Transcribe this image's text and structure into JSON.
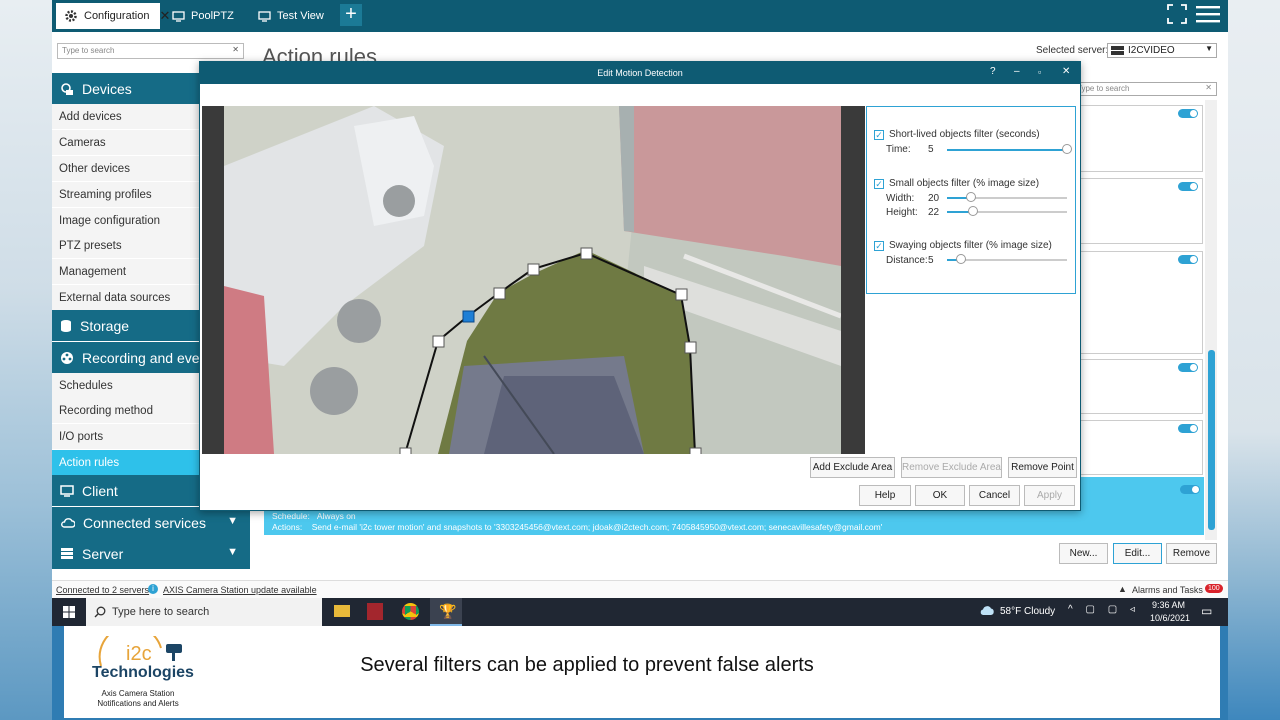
{
  "tabs": [
    {
      "label": "Configuration",
      "icon": "gear-icon"
    },
    {
      "label": "PoolPTZ",
      "icon": "monitor-icon"
    },
    {
      "label": "Test View",
      "icon": "monitor-icon"
    }
  ],
  "sidebar": {
    "search_placeholder": "Type to search",
    "devices": {
      "title": "Devices",
      "items": [
        "Add devices",
        "Cameras",
        "Other devices",
        "Streaming profiles",
        "Image configuration",
        "PTZ presets",
        "Management",
        "External data sources"
      ]
    },
    "storage": {
      "title": "Storage"
    },
    "recording": {
      "title": "Recording and events",
      "items": [
        "Schedules",
        "Recording method",
        "I/O ports",
        "Action rules"
      ]
    },
    "client": {
      "title": "Client"
    },
    "connected": {
      "title": "Connected services"
    },
    "server": {
      "title": "Server"
    }
  },
  "main": {
    "title": "Action rules",
    "selected_server_label": "Selected server:",
    "selected_server_value": "I2CVIDEO",
    "search_placeholder": "Type to search",
    "rule": {
      "schedule_label": "Schedule:",
      "schedule_value": "Always on",
      "actions_label": "Actions:",
      "actions_value": "Send e-mail 'i2c tower motion' and snapshots to '3303245456@vtext.com; jdoak@i2ctech.com; 7405845950@vtext.com; senecavillesafety@gmail.com'"
    },
    "buttons": {
      "new": "New...",
      "edit": "Edit...",
      "remove": "Remove"
    }
  },
  "status": {
    "connected": "Connected to 2 servers",
    "update": "AXIS Camera Station update available",
    "alarms": "Alarms and Tasks",
    "alarms_count": "100"
  },
  "dialog": {
    "title": "Edit Motion Detection",
    "help_icon": "?",
    "filters": {
      "short_lived": {
        "label": "Short-lived objects filter (seconds)",
        "checked": true,
        "time_label": "Time:",
        "time_value": "5",
        "level": 1.0
      },
      "small": {
        "label": "Small objects filter (% image size)",
        "checked": true,
        "width_label": "Width:",
        "width_value": "20",
        "width_level": 0.2,
        "height_label": "Height:",
        "height_value": "22",
        "height_level": 0.22
      },
      "swaying": {
        "label": "Swaying objects filter (% image size)",
        "checked": true,
        "distance_label": "Distance:",
        "distance_value": "5",
        "distance_level": 0.12
      }
    },
    "buttons": {
      "add_exclude": "Add Exclude Area",
      "remove_exclude": "Remove Exclude Area",
      "remove_point": "Remove Point",
      "help": "Help",
      "ok": "OK",
      "cancel": "Cancel",
      "apply": "Apply"
    }
  },
  "taskbar": {
    "search_placeholder": "Type here to search",
    "weather": "58°F  Cloudy",
    "time": "9:36 AM",
    "date": "10/6/2021"
  },
  "banner": {
    "caption": "Several filters can be applied to prevent false alerts",
    "logo_name": "i2c",
    "logo_word": "Technologies",
    "logo_sub_1": "Axis Camera Station",
    "logo_sub_2": "Notifications and Alerts"
  },
  "colors": {
    "title_bar": "#0e5b73",
    "accent": "#2ea2d4",
    "selected": "#2ec1ea"
  }
}
